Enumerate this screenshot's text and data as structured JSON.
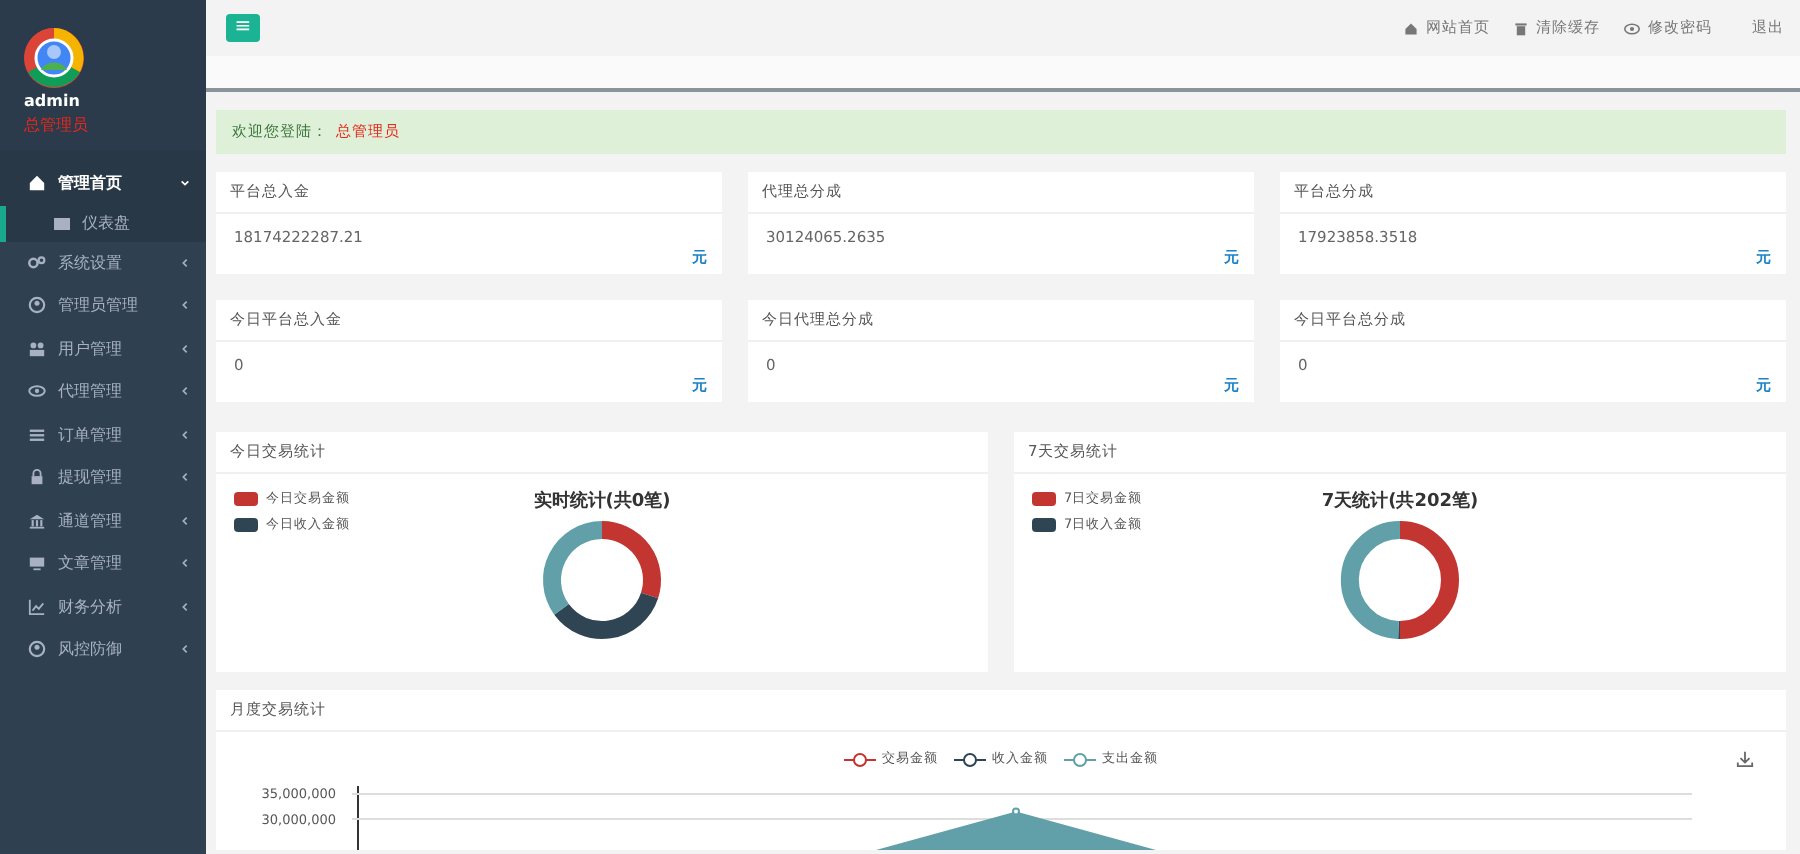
{
  "sidebar": {
    "user": {
      "name": "admin",
      "role": "总管理员"
    },
    "items": [
      {
        "label": "管理首页",
        "selected": true,
        "expanded": true,
        "children": [
          {
            "label": "仪表盘"
          }
        ]
      },
      {
        "label": "系统设置",
        "selected": false,
        "expanded": false
      },
      {
        "label": "管理员管理",
        "selected": false,
        "expanded": false
      },
      {
        "label": "用户管理",
        "selected": false,
        "expanded": false
      },
      {
        "label": "代理管理",
        "selected": false,
        "expanded": false
      },
      {
        "label": "订单管理",
        "selected": false,
        "expanded": false
      },
      {
        "label": "提现管理",
        "selected": false,
        "expanded": false
      },
      {
        "label": "通道管理",
        "selected": false,
        "expanded": false
      },
      {
        "label": "文章管理",
        "selected": false,
        "expanded": false
      },
      {
        "label": "财务分析",
        "selected": false,
        "expanded": false
      },
      {
        "label": "风控防御",
        "selected": false,
        "expanded": false
      }
    ]
  },
  "topbar": {
    "menu_button": "≡",
    "links": [
      {
        "label": "网站首页"
      },
      {
        "label": "清除缓存"
      },
      {
        "label": "修改密码"
      },
      {
        "label": "退出"
      }
    ]
  },
  "welcome": {
    "text": "欢迎您登陆：",
    "role": "总管理员"
  },
  "stats": [
    {
      "title": "平台总入金",
      "value": "18174222287.21",
      "unit": "元"
    },
    {
      "title": "代理总分成",
      "value": "30124065.2635",
      "unit": "元"
    },
    {
      "title": "平台总分成",
      "value": "17923858.3518",
      "unit": "元"
    },
    {
      "title": "今日平台总入金",
      "value": "0",
      "unit": "元"
    },
    {
      "title": "今日代理总分成",
      "value": "0",
      "unit": "元"
    },
    {
      "title": "今日平台总分成",
      "value": "0",
      "unit": "元"
    }
  ],
  "donut_panels": [
    {
      "title": "今日交易统计",
      "chart_title": "实时统计(共0笔)",
      "legend": [
        {
          "label": "今日交易金额",
          "color": "#c23531"
        },
        {
          "label": "今日收入金额",
          "color": "#2f4554"
        }
      ]
    },
    {
      "title": "7天交易统计",
      "chart_title": "7天统计(共202笔)",
      "legend": [
        {
          "label": "7日交易金额",
          "color": "#c23531"
        },
        {
          "label": "7日收入金额",
          "color": "#2f4554"
        }
      ]
    }
  ],
  "monthly": {
    "title": "月度交易统计",
    "chart_data": {
      "type": "area",
      "ylim": [
        23800000,
        35000000
      ],
      "yticks": [
        {
          "value": 30000000,
          "label": "30,000,000"
        },
        {
          "value": 35000000,
          "label": "35,000,000"
        }
      ],
      "series": [
        {
          "name": "交易金额",
          "color": "#c23531"
        },
        {
          "name": "收入金额",
          "color": "#2f4554"
        },
        {
          "name": "支出金额",
          "color": "#61a0a8"
        }
      ]
    }
  }
}
